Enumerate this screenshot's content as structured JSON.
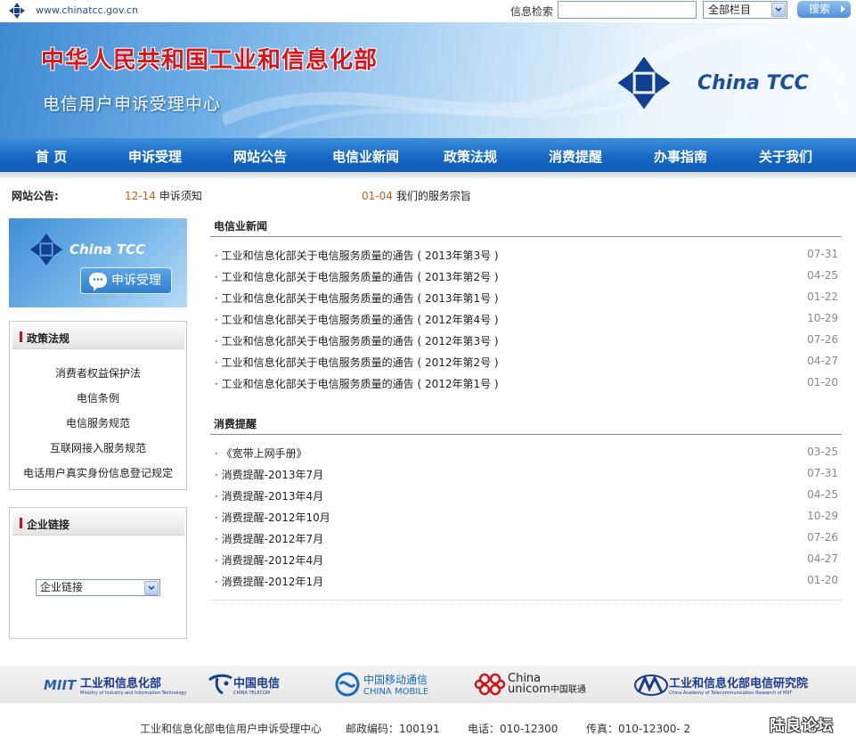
{
  "topbar": {
    "url": "www.chinatcc.gov.cn",
    "search_label": "信息检索",
    "search_value": "",
    "category_select": "全部栏目",
    "search_button": "搜索"
  },
  "banner": {
    "ministry_title": "中华人民共和国工业和信息化部",
    "center_title": "电信用户申诉受理中心",
    "brand": "China TCC"
  },
  "nav": {
    "items": [
      "首 页",
      "申诉受理",
      "网站公告",
      "电信业新闻",
      "政策法规",
      "消费提醒",
      "办事指南",
      "关于我们"
    ]
  },
  "notices": {
    "label": "网站公告:",
    "items": [
      {
        "date": "12-14",
        "title": "申诉须知"
      },
      {
        "date": "01-04",
        "title": "我们的服务宗旨"
      }
    ]
  },
  "promo": {
    "brand": "China TCC",
    "button": "申诉受理"
  },
  "policy_panel": {
    "title": "政策法规",
    "items": [
      "消费者权益保护法",
      "电信条例",
      "电信服务规范",
      "互联网接入服务规范",
      "电话用户真实身份信息登记规定"
    ]
  },
  "links_panel": {
    "title": "企业链接",
    "select": "企业链接"
  },
  "news": {
    "title": "电信业新闻",
    "items": [
      {
        "title": "· 工业和信息化部关于电信服务质量的通告 ( 2013年第3号 )",
        "date": "07-31"
      },
      {
        "title": "· 工业和信息化部关于电信服务质量的通告 ( 2013年第2号 )",
        "date": "04-25"
      },
      {
        "title": "· 工业和信息化部关于电信服务质量的通告 ( 2013年第1号 )",
        "date": "01-22"
      },
      {
        "title": "· 工业和信息化部关于电信服务质量的通告 ( 2012年第4号 )",
        "date": "10-29"
      },
      {
        "title": "· 工业和信息化部关于电信服务质量的通告 ( 2012年第3号 )",
        "date": "07-26"
      },
      {
        "title": "· 工业和信息化部关于电信服务质量的通告 ( 2012年第2号 )",
        "date": "04-27"
      },
      {
        "title": "· 工业和信息化部关于电信服务质量的通告 ( 2012年第1号 )",
        "date": "01-20"
      }
    ]
  },
  "reminders": {
    "title": "消费提醒",
    "items": [
      {
        "title": "· 《宽带上网手册》",
        "date": "03-25"
      },
      {
        "title": "· 消费提醒-2013年7月",
        "date": "07-31"
      },
      {
        "title": "· 消费提醒-2013年4月",
        "date": "04-25"
      },
      {
        "title": "· 消费提醒-2012年10月",
        "date": "10-29"
      },
      {
        "title": "· 消费提醒-2012年7月",
        "date": "07-26"
      },
      {
        "title": "· 消费提醒-2012年4月",
        "date": "04-27"
      },
      {
        "title": "· 消费提醒-2012年1月",
        "date": "01-20"
      }
    ]
  },
  "partners": {
    "miit": "工业和信息化部",
    "miit_sub": "Ministry of Industry and Information Technology",
    "telecom": "中国电信",
    "telecom_sub": "CHINA TELECOM",
    "mobile": "中国移动通信",
    "mobile_sub": "CHINA MOBILE",
    "unicom_en": "China",
    "unicom_en2": "unicom",
    "unicom": "中国联通",
    "caict": "工业和信息化部电信研究院",
    "caict_sub": "China Academy of Telecommunication Research of MIIT"
  },
  "footer": {
    "org": "工业和信息化部电信用户申诉受理中心",
    "postcode": "邮政编码：100191",
    "phone": "电话：010-12300",
    "fax": "传真：010-12300- 2",
    "watermark": "陆良论坛"
  },
  "colors": {
    "nav_blue": "#1366c2",
    "title_red": "#d9141b",
    "date_orange": "#c45e1b"
  }
}
